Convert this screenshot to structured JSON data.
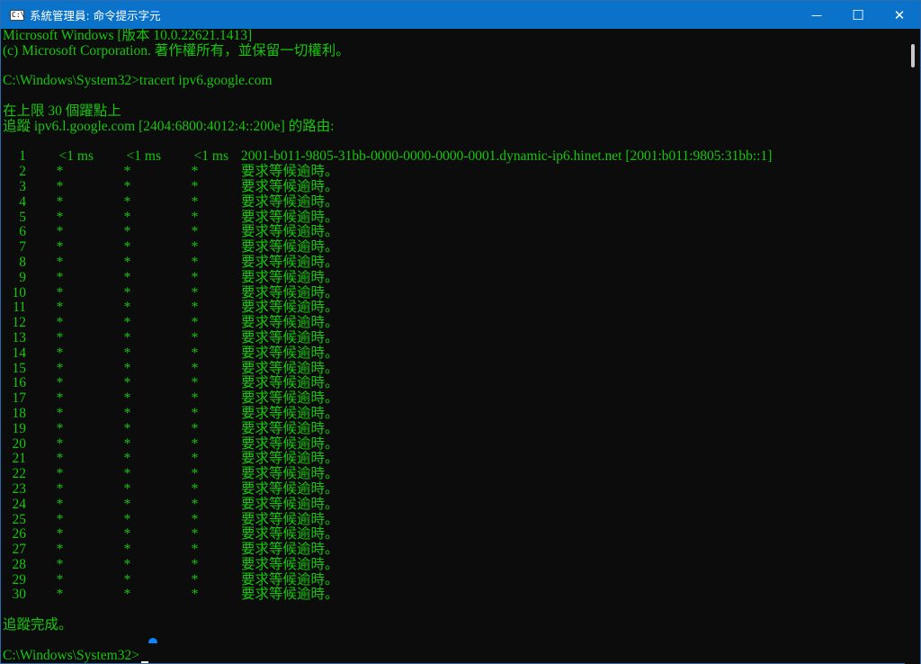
{
  "window": {
    "title": "系統管理員: 命令提示字元",
    "icon_label": "C:\\",
    "minimize": "—",
    "maximize": "☐",
    "close": "✕"
  },
  "console": {
    "header": [
      "Microsoft Windows [版本 10.0.22621.1413]",
      "(c) Microsoft Corporation. 著作權所有，並保留一切權利。"
    ],
    "command_line": "C:\\Windows\\System32>tracert ipv6.google.com",
    "trace_intro": [
      "在上限 30 個躍點上",
      "追蹤 ipv6.l.google.com [2404:6800:4012:4::200e] 的路由:"
    ],
    "hops": [
      {
        "n": "1",
        "t1": "<1 ms",
        "t2": "<1 ms",
        "t3": "<1 ms",
        "host": "2001-b011-9805-31bb-0000-0000-0000-0001.dynamic-ip6.hinet.net [2001:b011:9805:31bb::1]"
      },
      {
        "n": "2",
        "t1": "*",
        "t2": "*",
        "t3": "*",
        "host": "要求等候逾時。"
      },
      {
        "n": "3",
        "t1": "*",
        "t2": "*",
        "t3": "*",
        "host": "要求等候逾時。"
      },
      {
        "n": "4",
        "t1": "*",
        "t2": "*",
        "t3": "*",
        "host": "要求等候逾時。"
      },
      {
        "n": "5",
        "t1": "*",
        "t2": "*",
        "t3": "*",
        "host": "要求等候逾時。"
      },
      {
        "n": "6",
        "t1": "*",
        "t2": "*",
        "t3": "*",
        "host": "要求等候逾時。"
      },
      {
        "n": "7",
        "t1": "*",
        "t2": "*",
        "t3": "*",
        "host": "要求等候逾時。"
      },
      {
        "n": "8",
        "t1": "*",
        "t2": "*",
        "t3": "*",
        "host": "要求等候逾時。"
      },
      {
        "n": "9",
        "t1": "*",
        "t2": "*",
        "t3": "*",
        "host": "要求等候逾時。"
      },
      {
        "n": "10",
        "t1": "*",
        "t2": "*",
        "t3": "*",
        "host": "要求等候逾時。"
      },
      {
        "n": "11",
        "t1": "*",
        "t2": "*",
        "t3": "*",
        "host": "要求等候逾時。"
      },
      {
        "n": "12",
        "t1": "*",
        "t2": "*",
        "t3": "*",
        "host": "要求等候逾時。"
      },
      {
        "n": "13",
        "t1": "*",
        "t2": "*",
        "t3": "*",
        "host": "要求等候逾時。"
      },
      {
        "n": "14",
        "t1": "*",
        "t2": "*",
        "t3": "*",
        "host": "要求等候逾時。"
      },
      {
        "n": "15",
        "t1": "*",
        "t2": "*",
        "t3": "*",
        "host": "要求等候逾時。"
      },
      {
        "n": "16",
        "t1": "*",
        "t2": "*",
        "t3": "*",
        "host": "要求等候逾時。"
      },
      {
        "n": "17",
        "t1": "*",
        "t2": "*",
        "t3": "*",
        "host": "要求等候逾時。"
      },
      {
        "n": "18",
        "t1": "*",
        "t2": "*",
        "t3": "*",
        "host": "要求等候逾時。"
      },
      {
        "n": "19",
        "t1": "*",
        "t2": "*",
        "t3": "*",
        "host": "要求等候逾時。"
      },
      {
        "n": "20",
        "t1": "*",
        "t2": "*",
        "t3": "*",
        "host": "要求等候逾時。"
      },
      {
        "n": "21",
        "t1": "*",
        "t2": "*",
        "t3": "*",
        "host": "要求等候逾時。"
      },
      {
        "n": "22",
        "t1": "*",
        "t2": "*",
        "t3": "*",
        "host": "要求等候逾時。"
      },
      {
        "n": "23",
        "t1": "*",
        "t2": "*",
        "t3": "*",
        "host": "要求等候逾時。"
      },
      {
        "n": "24",
        "t1": "*",
        "t2": "*",
        "t3": "*",
        "host": "要求等候逾時。"
      },
      {
        "n": "25",
        "t1": "*",
        "t2": "*",
        "t3": "*",
        "host": "要求等候逾時。"
      },
      {
        "n": "26",
        "t1": "*",
        "t2": "*",
        "t3": "*",
        "host": "要求等候逾時。"
      },
      {
        "n": "27",
        "t1": "*",
        "t2": "*",
        "t3": "*",
        "host": "要求等候逾時。"
      },
      {
        "n": "28",
        "t1": "*",
        "t2": "*",
        "t3": "*",
        "host": "要求等候逾時。"
      },
      {
        "n": "29",
        "t1": "*",
        "t2": "*",
        "t3": "*",
        "host": "要求等候逾時。"
      },
      {
        "n": "30",
        "t1": "*",
        "t2": "*",
        "t3": "*",
        "host": "要求等候逾時。"
      }
    ],
    "trace_complete": "追蹤完成。",
    "prompt": "C:\\Windows\\System32>"
  },
  "colors": {
    "text": "#16c60c",
    "background": "#0c0c0c",
    "titlebar": "#0a72c9"
  }
}
